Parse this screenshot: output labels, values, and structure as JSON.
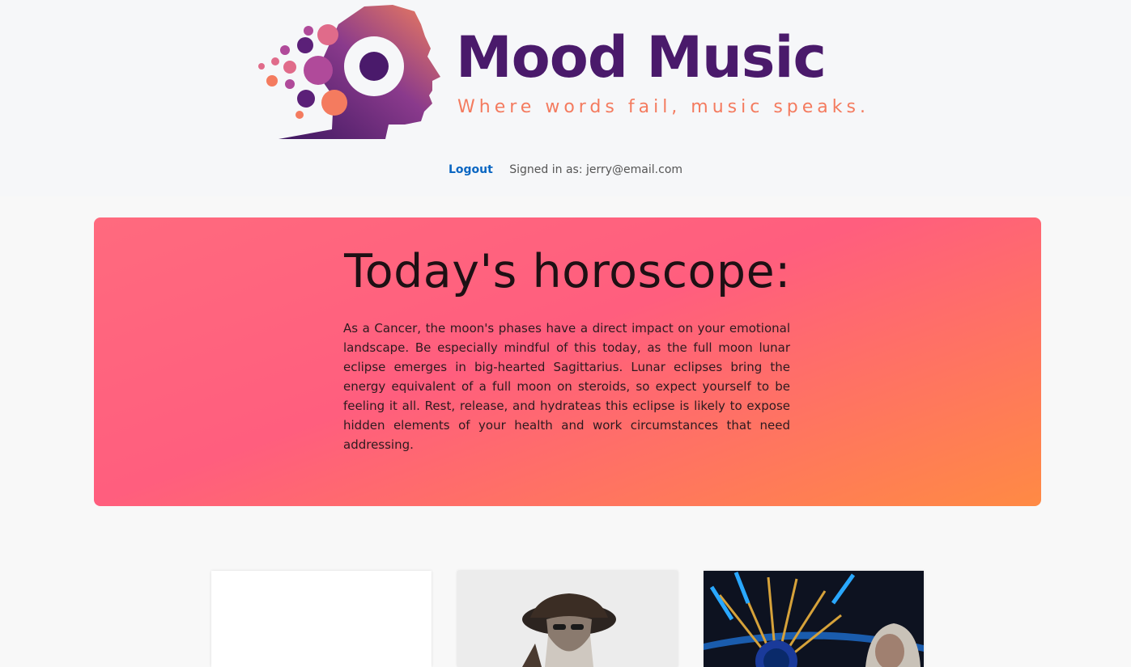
{
  "brand": {
    "title": "Mood Music",
    "tagline": "Where words fail, music speaks.",
    "colors": {
      "primary": "#4a1a6b",
      "accent": "#f47b5f"
    }
  },
  "nav": {
    "logout_label": "Logout",
    "signed_in_text": "Signed in as: jerry@email.com"
  },
  "horoscope": {
    "heading": "Today's horoscope:",
    "text": "As a Cancer, the moon's phases have a direct impact on your emotional landscape. Be especially mindful of this today, as the full moon lunar eclipse emerges in big-hearted Sagittarius. Lunar eclipses bring the energy equivalent of a full moon on steroids, so expect yourself to be feeling it all. Rest, release, and hydrateas this eclipse is likely to expose hidden elements of your health and work circumstances that need addressing."
  },
  "cards": [
    {
      "image": "blank-placeholder"
    },
    {
      "image": "artist-photo-hat"
    },
    {
      "image": "album-art-feathers"
    }
  ]
}
